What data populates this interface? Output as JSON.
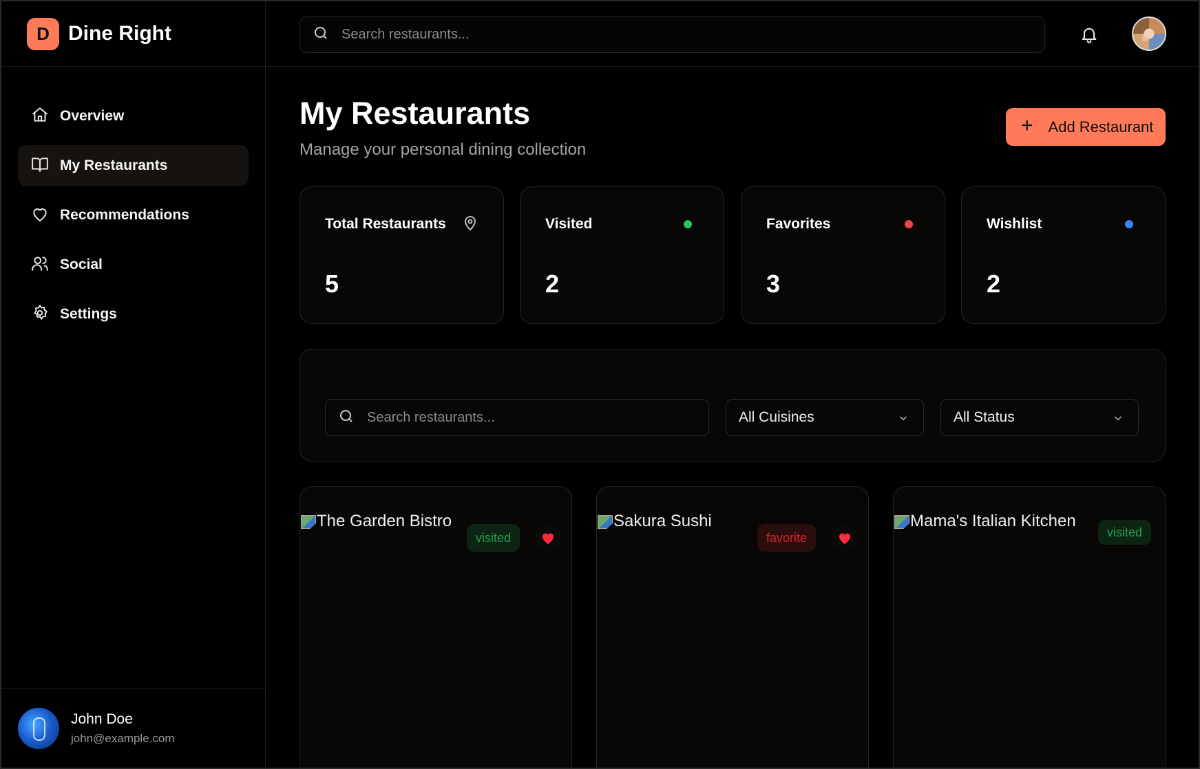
{
  "app": {
    "logo_letter": "D",
    "name": "Dine Right"
  },
  "sidebar": {
    "items": [
      {
        "label": "Overview",
        "icon": "home-icon",
        "active": false
      },
      {
        "label": "My Restaurants",
        "icon": "book-open-icon",
        "active": true
      },
      {
        "label": "Recommendations",
        "icon": "heart-outline-icon",
        "active": false
      },
      {
        "label": "Social",
        "icon": "users-icon",
        "active": false
      },
      {
        "label": "Settings",
        "icon": "gear-icon",
        "active": false
      }
    ],
    "user": {
      "name": "John Doe",
      "email": "john@example.com"
    }
  },
  "topbar": {
    "search_placeholder": "Search restaurants...",
    "notification_icon": "bell-icon"
  },
  "main": {
    "title": "My Restaurants",
    "subtitle": "Manage your personal dining collection",
    "add_button_label": "Add Restaurant"
  },
  "stats": [
    {
      "label": "Total Restaurants",
      "value": "5",
      "indicator": "map-pin-icon"
    },
    {
      "label": "Visited",
      "value": "2",
      "indicator": "dot",
      "color": "#22c55e"
    },
    {
      "label": "Favorites",
      "value": "3",
      "indicator": "dot",
      "color": "#ef4444"
    },
    {
      "label": "Wishlist",
      "value": "2",
      "indicator": "dot",
      "color": "#3b82f6"
    }
  ],
  "filters": {
    "search_placeholder": "Search restaurants...",
    "cuisine_selected": "All Cuisines",
    "status_selected": "All Status"
  },
  "restaurants": [
    {
      "name": "The Garden Bistro",
      "status": "visited",
      "favorite": true
    },
    {
      "name": "Sakura Sushi",
      "status": "favorite",
      "favorite": true
    },
    {
      "name": "Mama's Italian Kitchen",
      "status": "visited",
      "favorite": false
    }
  ],
  "colors": {
    "accent": "#ff7a59",
    "background": "#000000",
    "card": "#080706"
  }
}
